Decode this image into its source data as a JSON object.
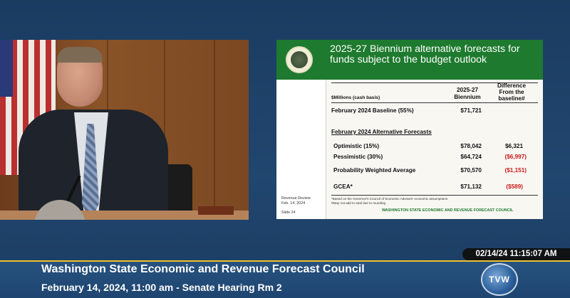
{
  "slide": {
    "title": "2025-27 Biennium alternative forecasts for funds subject to the budget outlook",
    "sidebar_label_1": "Revenue Review",
    "sidebar_label_2": "Feb. 14, 2024",
    "slide_number": "Slide 24",
    "col_label": "$Millions (cash basis)",
    "col_biennium_1": "2025-27",
    "col_biennium_2": "Biennium",
    "col_diff_1": "Difference",
    "col_diff_2": "From the",
    "col_diff_3": "baseline#",
    "baseline_label": "February 2024 Baseline (55%)",
    "baseline_value": "$71,721",
    "alt_heading": "February 2024 Alternative Forecasts",
    "rows": [
      {
        "label": "Optimistic (15%)",
        "value": "$78,042",
        "diff": "$6,321"
      },
      {
        "label": "Pessimistic (30%)",
        "value": "$64,724",
        "diff": "($6,997)"
      },
      {
        "label": "Probability Weighted Average",
        "value": "$70,570",
        "diff": "($1,151)"
      },
      {
        "label": "GCEA*",
        "value": "$71,132",
        "diff": "($589)"
      }
    ],
    "footnote_1": "*Based on the Governor's Council of Economic Advisors' economic assumptions",
    "footnote_2": "#May not add to total due to rounding",
    "council": "WASHINGTON STATE ECONOMIC AND REVENUE FORECAST COUNCIL"
  },
  "broadcast": {
    "timestamp": "02/14/24 11:15:07 AM",
    "title": "Washington State Economic and Revenue Forecast Council",
    "subtitle": "February 14, 2024, 11:00 am - Senate Hearing Rm 2",
    "logo_text": "TVW"
  },
  "colors": {
    "slide_header": "#1e7a2e",
    "negative": "#cc1a1a",
    "lower_bar": "#27527f",
    "accent_gold": "#f0c22e"
  },
  "icons": [
    "washington-state-seal-icon",
    "tvw-logo-icon"
  ]
}
